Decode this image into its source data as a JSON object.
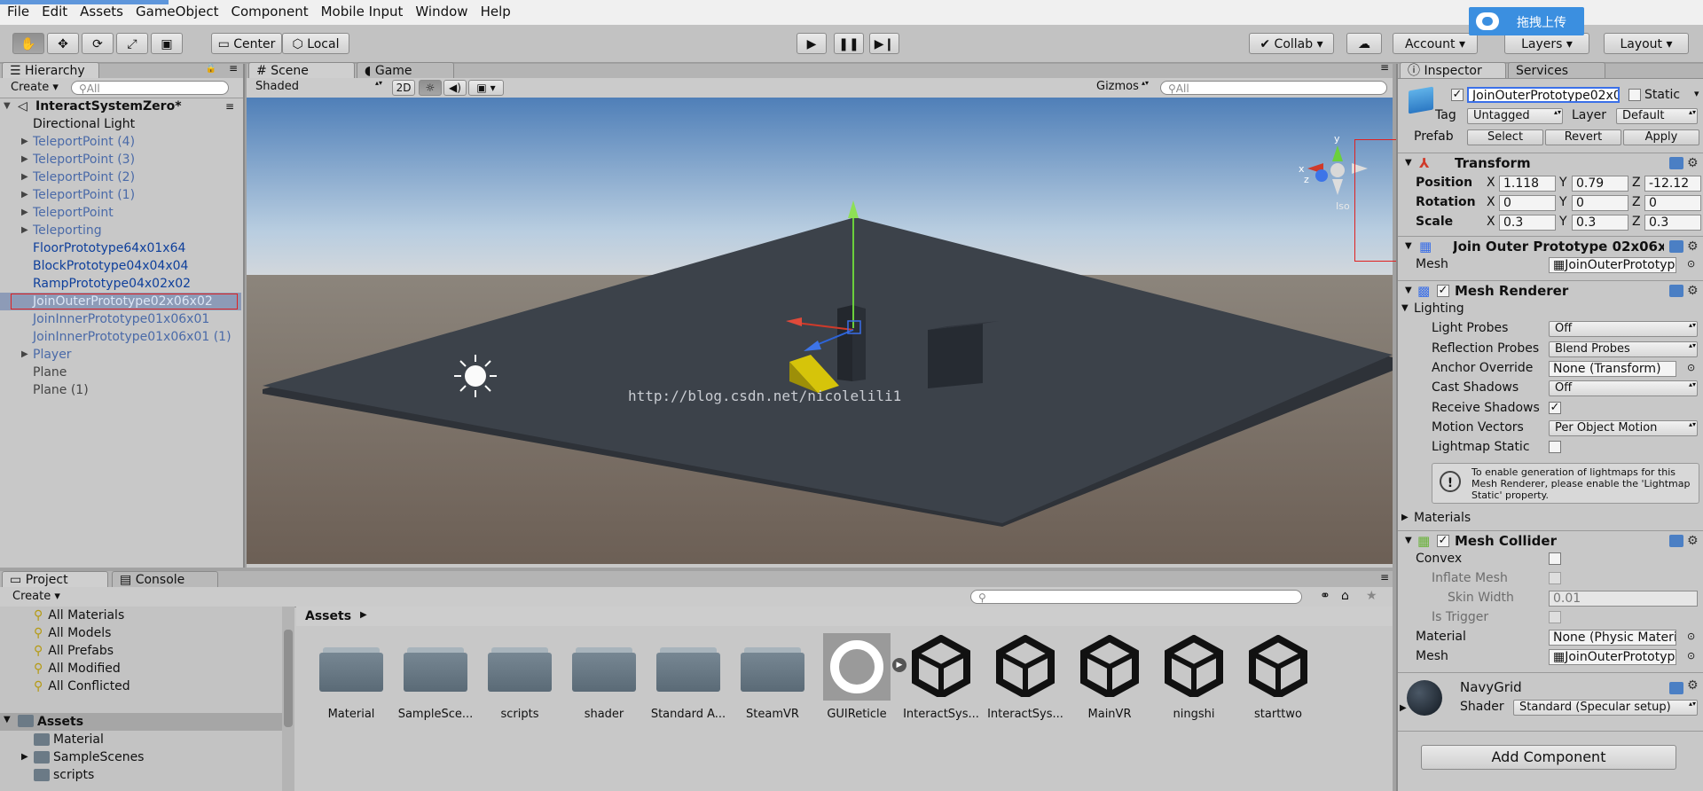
{
  "menu": [
    "File",
    "Edit",
    "Assets",
    "GameObject",
    "Component",
    "Mobile Input",
    "Window",
    "Help"
  ],
  "upload_label": "拖拽上传",
  "toolbar": {
    "pivot": "Center",
    "space": "Local",
    "collab": "Collab",
    "account": "Account",
    "layers": "Layers",
    "layout": "Layout"
  },
  "hierarchy": {
    "tab": "Hierarchy",
    "create": "Create",
    "search_placeholder": "All",
    "scene_name": "InteractSystemZero*",
    "items": [
      {
        "label": "Directional Light",
        "color": "black",
        "arrow": false
      },
      {
        "label": "TeleportPoint (4)",
        "color": "lblue",
        "arrow": true
      },
      {
        "label": "TeleportPoint (3)",
        "color": "lblue",
        "arrow": true
      },
      {
        "label": "TeleportPoint (2)",
        "color": "lblue",
        "arrow": true
      },
      {
        "label": "TeleportPoint (1)",
        "color": "lblue",
        "arrow": true
      },
      {
        "label": "TeleportPoint",
        "color": "lblue",
        "arrow": true
      },
      {
        "label": "Teleporting",
        "color": "lblue",
        "arrow": true
      },
      {
        "label": "FloorPrototype64x01x64",
        "color": "blue",
        "arrow": false
      },
      {
        "label": "BlockPrototype04x04x04",
        "color": "blue",
        "arrow": false
      },
      {
        "label": "RampPrototype04x02x02",
        "color": "blue",
        "arrow": false
      },
      {
        "label": "JoinOuterPrototype02x06x02",
        "color": "lblue",
        "arrow": false,
        "selected": true
      },
      {
        "label": "JoinInnerPrototype01x06x01",
        "color": "lblue",
        "arrow": false
      },
      {
        "label": "JoinInnerPrototype01x06x01 (1)",
        "color": "lblue",
        "arrow": false
      },
      {
        "label": "Player",
        "color": "lblue",
        "arrow": true
      },
      {
        "label": "Plane",
        "color": "dark",
        "arrow": false
      },
      {
        "label": "Plane (1)",
        "color": "dark",
        "arrow": false
      }
    ]
  },
  "scene": {
    "tab_scene": "Scene",
    "tab_game": "Game",
    "shading": "Shaded",
    "mode2d": "2D",
    "gizmos": "Gizmos",
    "search_placeholder": "All",
    "watermark": "http://blog.csdn.net/nicolelili1",
    "iso": "Iso",
    "axis_x": "x",
    "axis_y": "y",
    "axis_z": "z"
  },
  "inspector": {
    "tab_inspector": "Inspector",
    "tab_services": "Services",
    "object_name": "JoinOuterPrototype02x06",
    "static_label": "Static",
    "tag_label": "Tag",
    "tag_value": "Untagged",
    "layer_label": "Layer",
    "layer_value": "Default",
    "prefab_label": "Prefab",
    "prefab_select": "Select",
    "prefab_revert": "Revert",
    "prefab_apply": "Apply",
    "transform": {
      "title": "Transform",
      "position_label": "Position",
      "rotation_label": "Rotation",
      "scale_label": "Scale",
      "position": {
        "x": "1.118",
        "y": "0.79",
        "z": "-12.12"
      },
      "rotation": {
        "x": "0",
        "y": "0",
        "z": "0"
      },
      "scale": {
        "x": "0.3",
        "y": "0.3",
        "z": "0.3"
      }
    },
    "mesh_filter": {
      "title": "Join Outer Prototype 02x06x",
      "mesh_label": "Mesh",
      "mesh_value": "JoinOuterPrototyp"
    },
    "mesh_renderer": {
      "title": "Mesh Renderer",
      "lighting": "Lighting",
      "light_probes_label": "Light Probes",
      "light_probes_value": "Off",
      "reflection_probes_label": "Reflection Probes",
      "reflection_probes_value": "Blend Probes",
      "anchor_override_label": "Anchor Override",
      "anchor_override_value": "None (Transform)",
      "cast_shadows_label": "Cast Shadows",
      "cast_shadows_value": "Off",
      "receive_shadows_label": "Receive Shadows",
      "motion_vectors_label": "Motion Vectors",
      "motion_vectors_value": "Per Object Motion",
      "lightmap_static_label": "Lightmap Static",
      "info": "To enable generation of lightmaps for this Mesh Renderer, please enable the 'Lightmap Static' property.",
      "materials": "Materials"
    },
    "mesh_collider": {
      "title": "Mesh Collider",
      "convex_label": "Convex",
      "inflate_label": "Inflate Mesh",
      "skin_label": "Skin Width",
      "skin_value": "0.01",
      "trigger_label": "Is Trigger",
      "material_label": "Material",
      "material_value": "None (Physic Materi",
      "mesh_label": "Mesh",
      "mesh_value": "JoinOuterPrototyp"
    },
    "material": {
      "name": "NavyGrid",
      "shader_label": "Shader",
      "shader_value": "Standard (Specular setup)"
    },
    "add_component": "Add Component"
  },
  "project": {
    "tab_project": "Project",
    "tab_console": "Console",
    "create": "Create",
    "favorites": [
      "All Materials",
      "All Models",
      "All Prefabs",
      "All Modified",
      "All Conflicted"
    ],
    "assets_root": "Assets",
    "tree": [
      "Material",
      "SampleScenes",
      "scripts"
    ],
    "breadcrumb": "Assets",
    "assets": [
      {
        "label": "Material",
        "kind": "folder"
      },
      {
        "label": "SampleSce...",
        "kind": "folder"
      },
      {
        "label": "scripts",
        "kind": "folder"
      },
      {
        "label": "shader",
        "kind": "folder"
      },
      {
        "label": "Standard A...",
        "kind": "folder"
      },
      {
        "label": "SteamVR",
        "kind": "folder"
      },
      {
        "label": "GUIReticle",
        "kind": "ring"
      },
      {
        "label": "InteractSys...",
        "kind": "unity"
      },
      {
        "label": "InteractSys...",
        "kind": "unity"
      },
      {
        "label": "MainVR",
        "kind": "unity"
      },
      {
        "label": "ningshi",
        "kind": "unity"
      },
      {
        "label": "starttwo",
        "kind": "unity"
      }
    ]
  }
}
